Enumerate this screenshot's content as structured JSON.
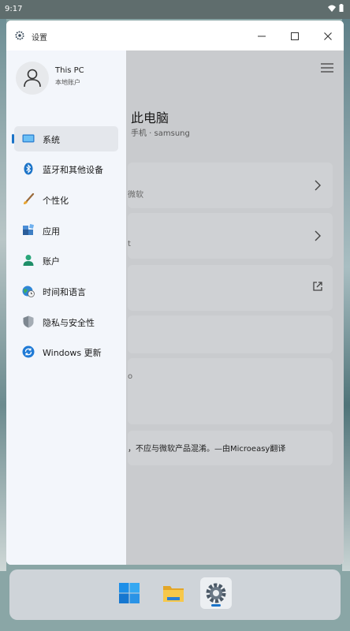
{
  "status": {
    "time": "9:17"
  },
  "window": {
    "title": "设置"
  },
  "user": {
    "name": "This PC",
    "subtitle": "本地账户"
  },
  "nav": {
    "items": [
      {
        "label": "系统",
        "icon": "display-icon",
        "active": true
      },
      {
        "label": "蓝牙和其他设备",
        "icon": "bluetooth-icon"
      },
      {
        "label": "个性化",
        "icon": "brush-icon"
      },
      {
        "label": "应用",
        "icon": "apps-icon"
      },
      {
        "label": "账户",
        "icon": "person-icon"
      },
      {
        "label": "时间和语言",
        "icon": "globe-clock-icon"
      },
      {
        "label": "隐私与安全性",
        "icon": "shield-icon"
      },
      {
        "label": "Windows 更新",
        "icon": "update-icon"
      }
    ]
  },
  "main": {
    "pc_name": "此电脑",
    "pc_subtitle": "手机 · samsung",
    "cards": [
      {
        "text": "微软"
      },
      {
        "text": "t"
      },
      {
        "text": ""
      },
      {
        "text": ""
      },
      {
        "text": "o"
      }
    ],
    "note": "，不应与微软产品混淆。—由Microeasy翻译"
  },
  "taskbar": {
    "apps": [
      "windows-start-icon",
      "file-explorer-icon",
      "settings-gear-icon"
    ]
  },
  "colors": {
    "accent": "#1a73c8"
  }
}
